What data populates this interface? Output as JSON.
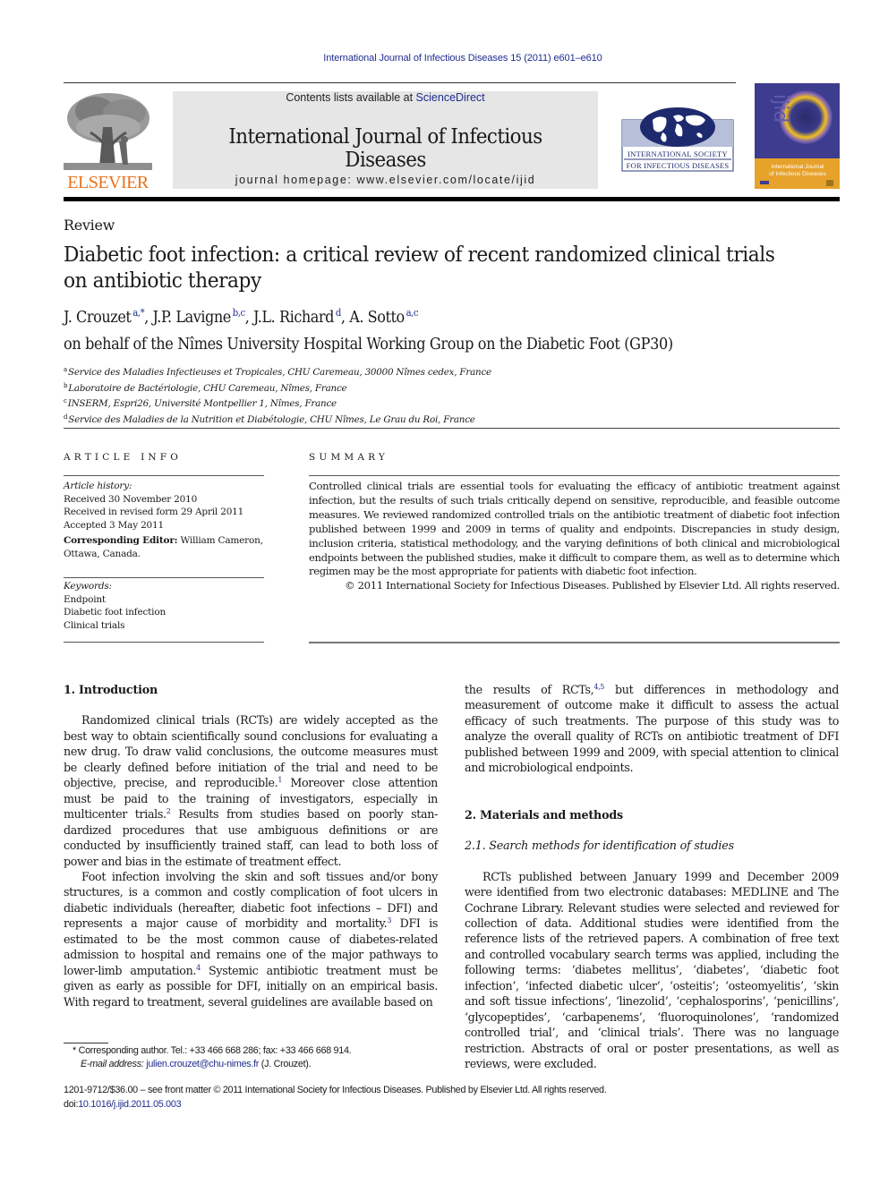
{
  "running_head": "International Journal of Infectious Diseases 15 (2011) e601–e610",
  "masthead": {
    "publisher_logo_text": "ELSEVIER",
    "contents_prefix": "Contents lists available at ",
    "contents_link": "ScienceDirect",
    "journal_title": "International Journal of Infectious Diseases",
    "homepage_label": "journal homepage: www.elsevier.com/locate/ijid",
    "society_logo_line1": "International Society",
    "society_logo_line2": "for Infectious Diseases",
    "cover_title_line1": "International Journal",
    "cover_title_line2": "of Infectious Diseases",
    "cover_acronym": "IJID",
    "accent_color": "#e9711c",
    "link_color": "#1f2d8f"
  },
  "article": {
    "section_type": "Review",
    "title": "Diabetic foot infection: a critical review of recent randomized clinical trials on antibiotic therapy",
    "authors": [
      {
        "name": "J. Crouzet",
        "affil": "a,*",
        "sep": ", "
      },
      {
        "name": "J.P. Lavigne",
        "affil": "b,c",
        "sep": ", "
      },
      {
        "name": "J.L. Richard",
        "affil": "d",
        "sep": ", "
      },
      {
        "name": "A. Sotto",
        "affil": "a,c",
        "sep": ""
      }
    ],
    "group": "on behalf of the Nîmes University Hospital Working Group on the Diabetic Foot (GP30)",
    "affiliations": [
      {
        "key": "a",
        "text": "Service des Maladies Infectieuses et Tropicales, CHU Caremeau, 30000 Nîmes cedex, France"
      },
      {
        "key": "b",
        "text": "Laboratoire de Bactériologie, CHU Caremeau, Nîmes, France"
      },
      {
        "key": "c",
        "text": "INSERM, Espri26, Université Montpellier 1, Nîmes, France"
      },
      {
        "key": "d",
        "text": "Service des Maladies de la Nutrition et Diabétologie, CHU Nîmes, Le Grau du Roi, France"
      }
    ]
  },
  "article_info": {
    "heading": "ARTICLE INFO",
    "history_label": "Article history:",
    "received": "Received 30 November 2010",
    "revised": "Received in revised form 29 April 2011",
    "accepted": "Accepted 3 May 2011",
    "editor_label": "Corresponding Editor:",
    "editor_value": " William Cameron, Ottawa, Canada.",
    "keywords_label": "Keywords:",
    "keywords": [
      "Endpoint",
      "Diabetic foot infection",
      "Clinical trials"
    ]
  },
  "summary": {
    "heading": "SUMMARY",
    "text": "Controlled clinical trials are essential tools for evaluating the efficacy of antibiotic treatment against infection, but the results of such trials critically depend on sensitive, reproducible, and feasible outcome measures. We reviewed randomized controlled trials on the antibiotic treatment of diabetic foot infection published between 1999 and 2009 in terms of quality and endpoints. Discrepancies in study design, inclusion criteria, statistical methodology, and the varying definitions of both clinical and microbiological endpoints between the published studies, make it difficult to compare them, as well as to determine which regimen may be the most appropriate for patients with diabetic foot infection.",
    "copyright": "© 2011 International Society for Infectious Diseases. Published by Elsevier Ltd. All rights reserved."
  },
  "body": {
    "intro_heading": "1.  Introduction",
    "intro_p1_a": "Randomized clinical trials (RCTs) are widely accepted as the best way to obtain scientifically sound conclusions for evaluating a new drug. To draw valid conclusions, the outcome measures must be clearly defined before initiation of the trial and need to be objective, precise, and reproducible.",
    "ref1": "1",
    "intro_p1_b": " Moreover close attention must be paid to the training of investigators, especially in multicenter trials.",
    "ref2": "2",
    "intro_p1_c": " Results from studies based on poorly stan-dardized procedures that use ambiguous definitions or are conducted by insufficiently trained staff, can lead to both loss of power and bias in the estimate of treatment effect.",
    "intro_p2_a": "Foot infection involving the skin and soft tissues and/or bony structures, is a common and costly complication of foot ulcers in diabetic individuals (hereafter, diabetic foot infections – DFI) and represents a major cause of morbidity and mortality.",
    "ref3": "3",
    "intro_p2_b": " DFI is estimated to be the most common cause of diabetes-related admission to hospital and remains one of the major pathways to lower-limb amputation.",
    "ref4": "4",
    "intro_p2_c": " Systemic antibiotic treatment must be given as early as possible for DFI, initially on an empirical basis. With regard to treatment, several guidelines are available based on",
    "col2_p1_a": "the results of RCTs,",
    "ref45": "4,5",
    "col2_p1_b": " but differences in methodology and measurement of outcome make it difficult to assess the actual efficacy of such treatments. The purpose of this study was to analyze the overall quality of RCTs on antibiotic treatment of DFI published between 1999 and 2009, with special attention to clinical and microbiological endpoints.",
    "methods_heading": "2.  Materials and methods",
    "search_subheading": "2.1.  Search methods for identification of studies",
    "methods_p1": "RCTs published between January 1999 and December 2009 were identified from two electronic databases: MEDLINE and The Cochrane Library. Relevant studies were selected and reviewed for collection of data. Additional studies were identified from the reference lists of the retrieved papers. A combination of free text and controlled vocabulary search terms was applied, including the following terms: ‘diabetes mellitus’, ‘diabetes’, ‘diabetic foot infection’, ‘infected diabetic ulcer’, ‘osteitis’; ‘osteomyelitis’, ‘skin and soft tissue infections’, ‘linezolid’, ‘cephalosporins’, ‘penicillins’, ‘glycopeptides’, ‘carbapenems’, ‘fluoroquinolones’, ‘randomized controlled trial’, and ‘clinical trials’. There was no language restriction. Abstracts of oral or poster presentations, as well as reviews, were excluded."
  },
  "footnote": {
    "marker": "*",
    "corresponding": " Corresponding author. Tel.: +33 466 668 286; fax: +33 466 668 914.",
    "email_label": "E-mail address:",
    "email": "julien.crouzet@chu-nimes.fr",
    "email_suffix": " (J. Crouzet)."
  },
  "bottom": {
    "issn_line": "1201-9712/$36.00 – see front matter © 2011 International Society for Infectious Diseases. Published by Elsevier Ltd. All rights reserved.",
    "doi_prefix": "doi:",
    "doi": "10.1016/j.ijid.2011.05.003"
  }
}
